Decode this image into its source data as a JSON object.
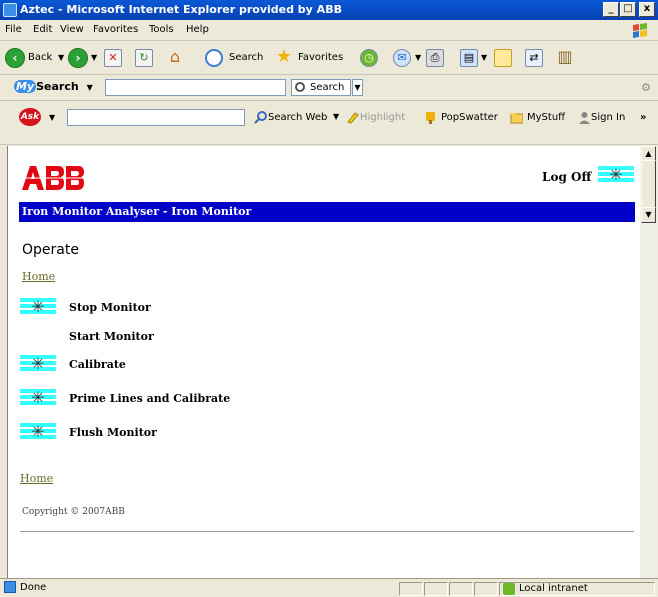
{
  "window": {
    "title": "Aztec - Microsoft Internet Explorer provided by ABB",
    "controls": [
      "_",
      "□",
      "x"
    ]
  },
  "menu": [
    "File",
    "Edit",
    "View",
    "Favorites",
    "Tools",
    "Help"
  ],
  "toolbar": {
    "back_label": "Back",
    "search_label": "Search",
    "favorites_label": "Favorites"
  },
  "mysearch": {
    "brand_my": "My",
    "brand_search": "Search",
    "input_value": "",
    "button_label": "Search"
  },
  "askbar": {
    "brand": "Ask",
    "input_value": "",
    "search_web": "Search Web",
    "highlight": "Highlight",
    "popswatter": "PopSwatter",
    "mystuff": "MyStuff",
    "sign_in": "Sign In"
  },
  "page": {
    "logo_text": "ABB",
    "log_off": "Log Off",
    "banner": "Iron Monitor Analyser - Iron Monitor",
    "heading": "Operate",
    "home_top": "Home",
    "actions": [
      {
        "label": "Stop Monitor",
        "has_icon": true
      },
      {
        "label": "Start Monitor",
        "has_icon": false
      },
      {
        "label": "Calibrate",
        "has_icon": true
      },
      {
        "label": "Prime Lines and Calibrate",
        "has_icon": true
      },
      {
        "label": "Flush Monitor",
        "has_icon": true
      }
    ],
    "home_bottom": "Home",
    "copyright": "Copyright © 2007ABB"
  },
  "status": {
    "left": "Done",
    "zone": "Local intranet"
  },
  "colors": {
    "banner_bg": "#0000c8",
    "logo_red": "#e30613",
    "link": "#6b6b2b",
    "icon_stripe": "#33ffff"
  }
}
